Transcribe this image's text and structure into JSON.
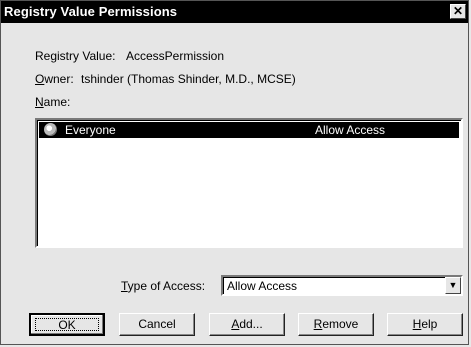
{
  "window": {
    "title": "Registry Value Permissions",
    "close_glyph": "✕"
  },
  "info": {
    "registry_value_label": "Registry Value:",
    "registry_value": "AccessPermission",
    "owner_label_prefix": "O",
    "owner_label_rest": "wner:",
    "owner_value": "tshinder (Thomas Shinder, M.D., MCSE)",
    "name_label_prefix": "N",
    "name_label_rest": "ame:"
  },
  "permissions_list": {
    "rows": [
      {
        "icon": "globe-icon",
        "name": "Everyone",
        "access": "Allow Access",
        "selected": true
      }
    ]
  },
  "type_of_access": {
    "label_prefix": "T",
    "label_rest": "ype of Access:",
    "selected": "Allow Access",
    "arrow": "▼"
  },
  "buttons": {
    "ok": "OK",
    "cancel": "Cancel",
    "add_prefix": "A",
    "add_rest": "dd...",
    "remove_prefix": "R",
    "remove_rest": "emove",
    "help_prefix": "H",
    "help_rest": "elp"
  }
}
